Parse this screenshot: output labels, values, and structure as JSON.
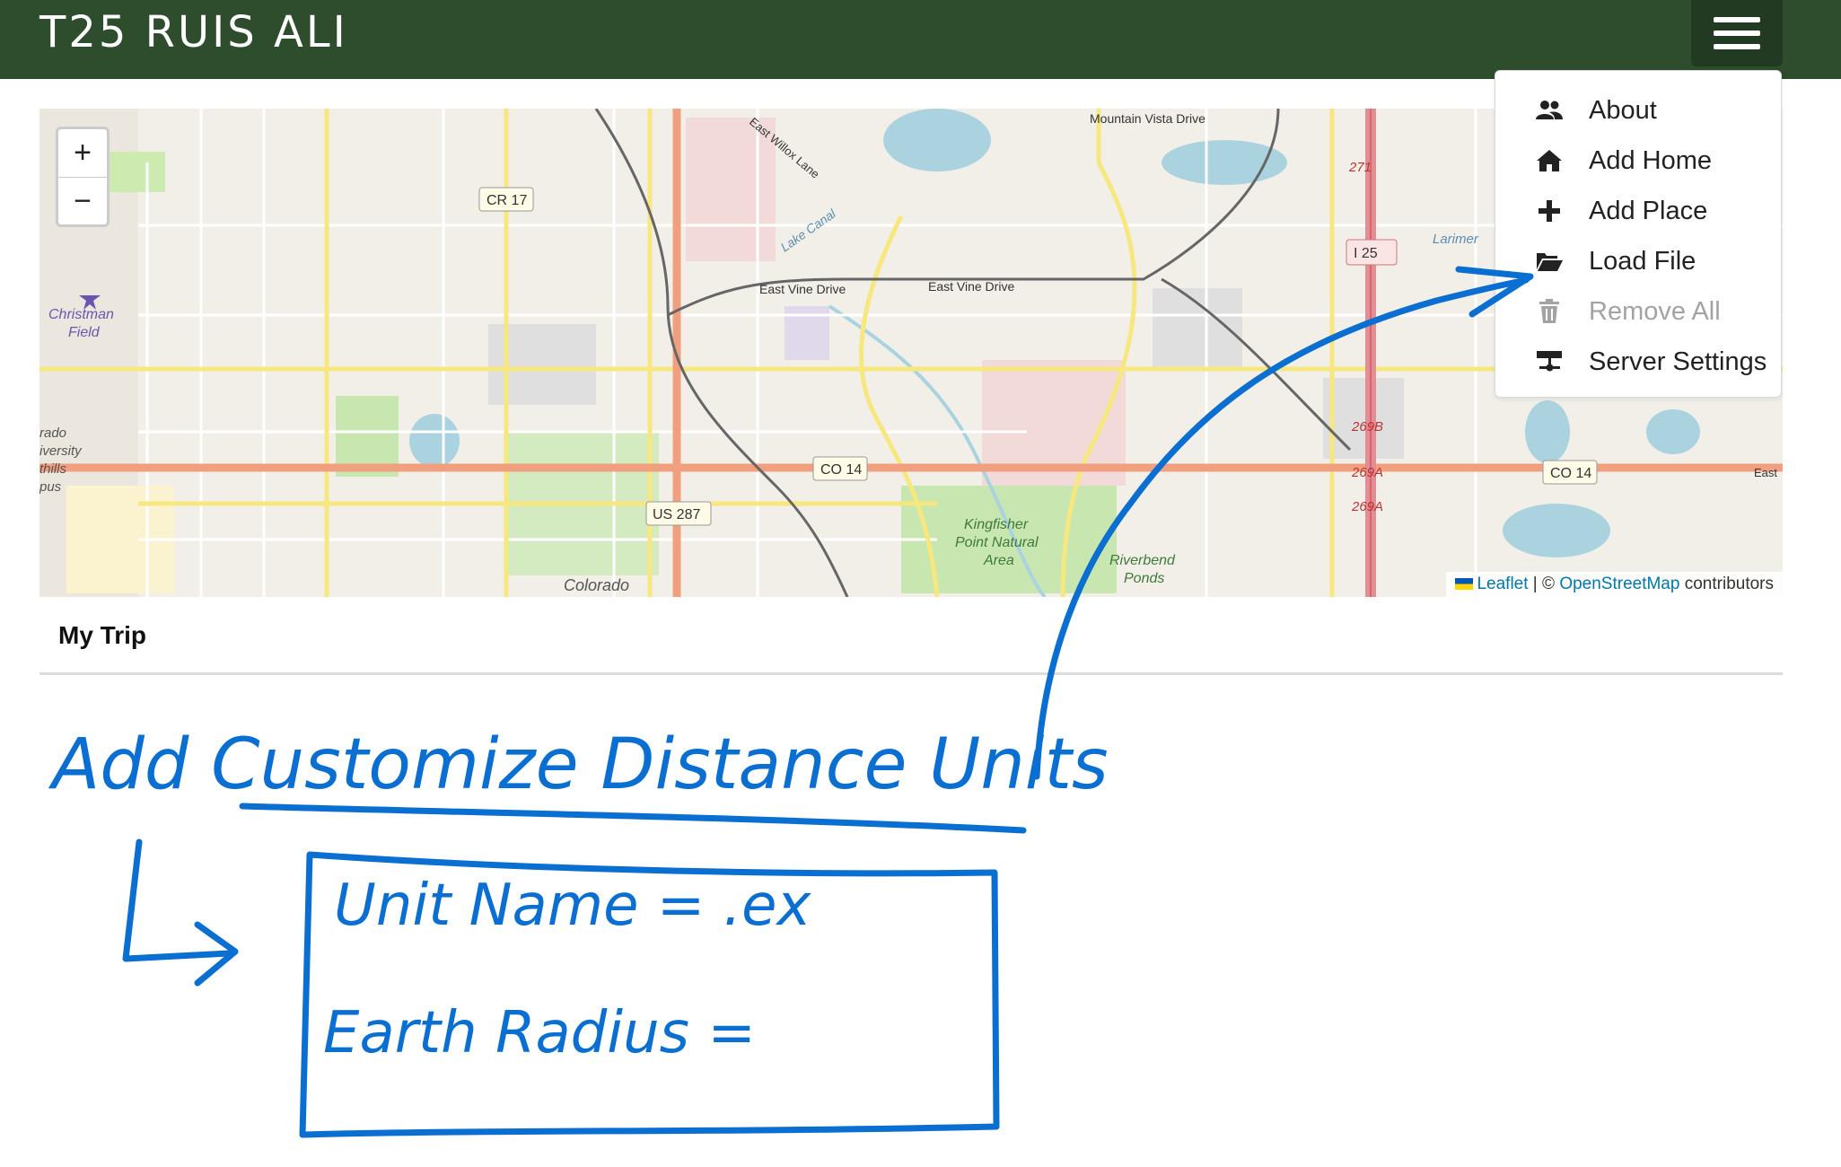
{
  "app": {
    "title": "T25 RUIS ALI"
  },
  "menu": {
    "items": [
      {
        "label": "About",
        "icon": "users-icon",
        "enabled": true
      },
      {
        "label": "Add Home",
        "icon": "home-icon",
        "enabled": true
      },
      {
        "label": "Add Place",
        "icon": "plus-icon",
        "enabled": true
      },
      {
        "label": "Load File",
        "icon": "folder-open-icon",
        "enabled": true
      },
      {
        "label": "Remove All",
        "icon": "trash-icon",
        "enabled": false
      },
      {
        "label": "Server Settings",
        "icon": "server-icon",
        "enabled": true
      }
    ]
  },
  "map": {
    "zoom_in": "+",
    "zoom_out": "−",
    "labels": {
      "mountain_vista": "Mountain Vista Drive",
      "east_willox": "East Willox Lane",
      "cr17": "CR 17",
      "lake_canal": "Lake Canal",
      "east_vine_1": "East Vine Drive",
      "east_vine_2": "East Vine Drive",
      "christman_1": "Christman",
      "christman_2": "Field",
      "co14_a": "CO 14",
      "co14_b": "CO 14",
      "us287": "US 287",
      "i25": "I 25",
      "r271": "271",
      "r269b": "269B",
      "r269a1": "269A",
      "r269a2": "269A",
      "kingfisher_1": "Kingfisher",
      "kingfisher_2": "Point Natural",
      "kingfisher_3": "Area",
      "riverbend_1": "Riverbend",
      "riverbend_2": "Ponds",
      "colorado": "Colorado",
      "larimer": "Larimer",
      "east": "East",
      "csu_1": "rado",
      "csu_2": "iversity",
      "csu_3": "thills",
      "csu_4": "pus"
    },
    "attribution": {
      "leaflet": "Leaflet",
      "separator": " | © ",
      "osm": "OpenStreetMap",
      "suffix": " contributors"
    }
  },
  "trip": {
    "title": "My Trip"
  },
  "sketch": {
    "heading": "Add Customize Distance Units",
    "line1": "Unit Name = .ex",
    "line2": "Earth Radius =",
    "color": "#0a6fd1"
  },
  "colors": {
    "header": "#2e4d2d",
    "accent": "#0a6fd1"
  }
}
